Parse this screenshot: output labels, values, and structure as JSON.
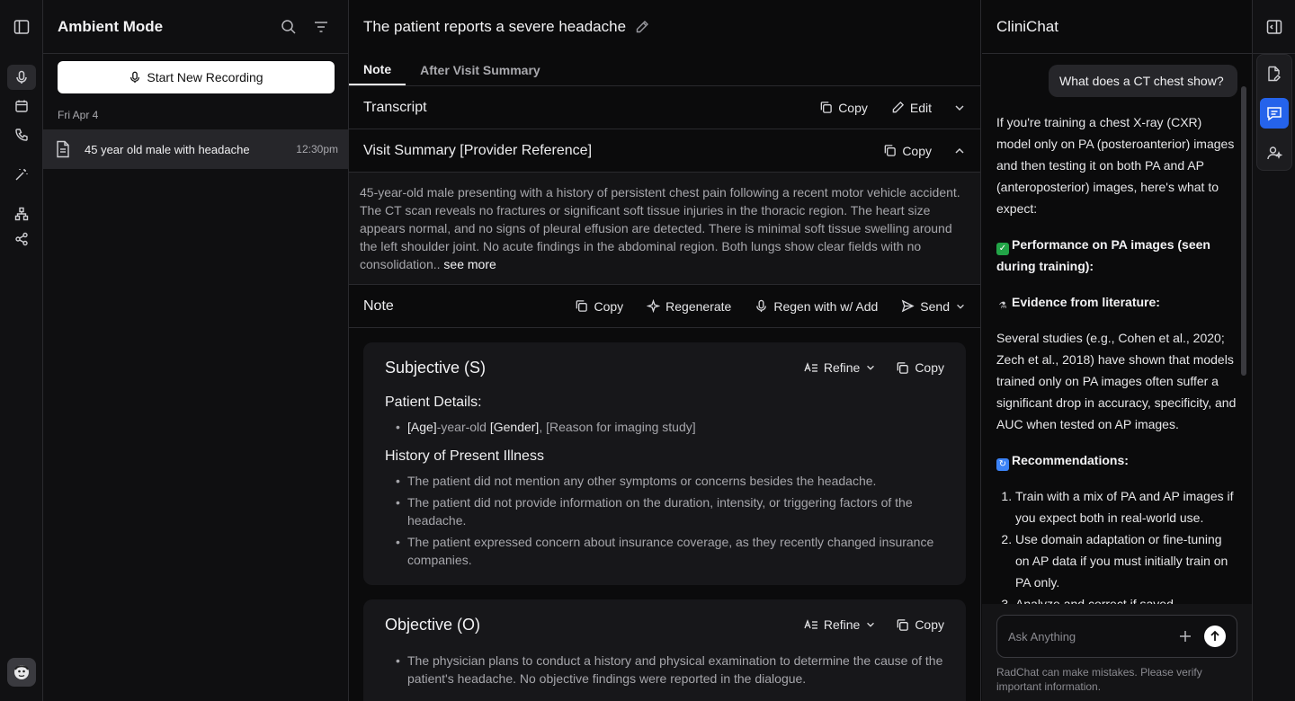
{
  "rail": {
    "icons": [
      "sidebar-toggle-icon",
      "microphone-icon",
      "calendar-icon",
      "phone-icon",
      "magic-wand-icon",
      "hierarchy-icon",
      "share-icon"
    ],
    "active": "microphone-icon"
  },
  "sidebar": {
    "title": "Ambient Mode",
    "record_label": "Start New Recording",
    "date": "Fri Apr 4",
    "encounter": {
      "title": "45 year old male with headache",
      "time": "12:30pm"
    }
  },
  "main": {
    "title": "The patient reports a severe headache",
    "tabs": [
      {
        "label": "Note",
        "active": true
      },
      {
        "label": "After Visit Summary",
        "active": false
      }
    ],
    "transcript": {
      "label": "Transcript",
      "copy": "Copy",
      "edit": "Edit"
    },
    "visit_summary": {
      "label": "Visit Summary [Provider Reference]",
      "copy": "Copy",
      "text": "45-year-old male presenting with a history of persistent chest pain following a recent motor vehicle accident. The CT scan reveals no fractures or significant soft tissue injuries in the thoracic region. The heart size appears normal, and no signs of pleural effusion are detected. There is minimal soft tissue swelling around the left shoulder joint. No acute findings in the abdominal region. Both lungs show clear fields with no consolidation..",
      "see_more": "see more"
    },
    "note": {
      "label": "Note",
      "copy": "Copy",
      "regenerate": "Regenerate",
      "regen_add": "Regen with w/ Add",
      "send": "Send"
    },
    "subjective": {
      "title": "Subjective (S)",
      "refine": "Refine",
      "copy": "Copy",
      "patient_details_heading": "Patient Details:",
      "pd_age": "[Age]",
      "pd_mid1": "-year-old ",
      "pd_gender": "[Gender]",
      "pd_rest": ", [Reason for imaging study]",
      "hpi_heading": "History of Present Illness",
      "hpi": [
        "The patient did not mention any other symptoms or concerns besides the headache.",
        "The patient did not provide information on the duration, intensity, or triggering factors of the headache.",
        "The patient expressed concern about insurance coverage, as they recently changed insurance companies."
      ]
    },
    "objective": {
      "title": "Objective (O)",
      "refine": "Refine",
      "copy": "Copy",
      "items": [
        "The physician plans to conduct a history and physical examination to determine the cause of the patient's headache. No objective findings were reported in the dialogue."
      ]
    }
  },
  "chat": {
    "title": "CliniChat",
    "user_message": "What does a CT chest show?",
    "intro": "If you're training a chest X-ray (CXR) model only on PA (posteroanterior) images and then testing it on both PA and AP (anteroposterior) images, here's what to expect:",
    "perf_heading": "Performance on PA images (seen during training):",
    "evidence_heading": "Evidence from literature:",
    "evidence_text": "Several studies (e.g., Cohen et al., 2020; Zech et al., 2018) have shown that models trained only on PA images often suffer a significant drop in accuracy, specificity, and AUC when tested on AP images.",
    "rec_heading": "Recommendations:",
    "recommendations": [
      "Train with a mix of PA and AP images if you expect both in real-world use.",
      "Use domain adaptation or fine-tuning on AP data if you must initially train on PA only.",
      "Analyze and correct if saved..."
    ],
    "input_placeholder": "Ask Anything",
    "disclaimer": "RadChat can make mistakes. Please verify important information."
  },
  "right_rail": {
    "icons": [
      "panel-collapse-icon",
      "document-edit-icon",
      "chat-icon",
      "assistant-icon"
    ],
    "active": "chat-icon"
  },
  "colors": {
    "accent": "#2563eb",
    "check": "#22a447",
    "recycle": "#3b82f6"
  }
}
